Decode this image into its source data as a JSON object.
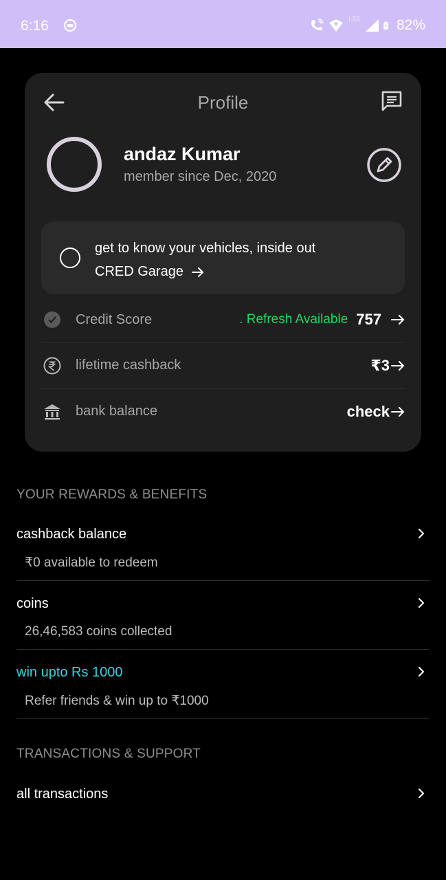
{
  "status_bar": {
    "time": "6:16",
    "network": "LTE",
    "battery": "82%"
  },
  "header": {
    "title": "Profile"
  },
  "profile": {
    "name": "andaz Kumar",
    "member_since": "member since Dec, 2020"
  },
  "garage": {
    "text": "get to know your vehicles, inside out",
    "link": "CRED Garage"
  },
  "rows": [
    {
      "label": "Credit Score",
      "refresh": ". Refresh Available",
      "value": "757"
    },
    {
      "label": "lifetime cashback",
      "value": "₹3"
    },
    {
      "label": "bank balance",
      "value": "check"
    }
  ],
  "rewards": {
    "heading": "YOUR REWARDS & BENEFITS",
    "items": [
      {
        "title": "cashback balance",
        "subtitle": "₹0 available to redeem"
      },
      {
        "title": "coins",
        "subtitle": "26,46,583 coins collected"
      },
      {
        "title": "win upto Rs 1000",
        "subtitle": "Refer friends & win up to ₹1000"
      }
    ]
  },
  "transactions": {
    "heading": "TRANSACTIONS & SUPPORT",
    "items": [
      {
        "title": "all transactions"
      }
    ]
  },
  "colors": {
    "status_bar": "#cfbef7",
    "card": "#1f1f20",
    "refresh_green": "#1ed760",
    "promo_cyan": "#35d4e6"
  }
}
